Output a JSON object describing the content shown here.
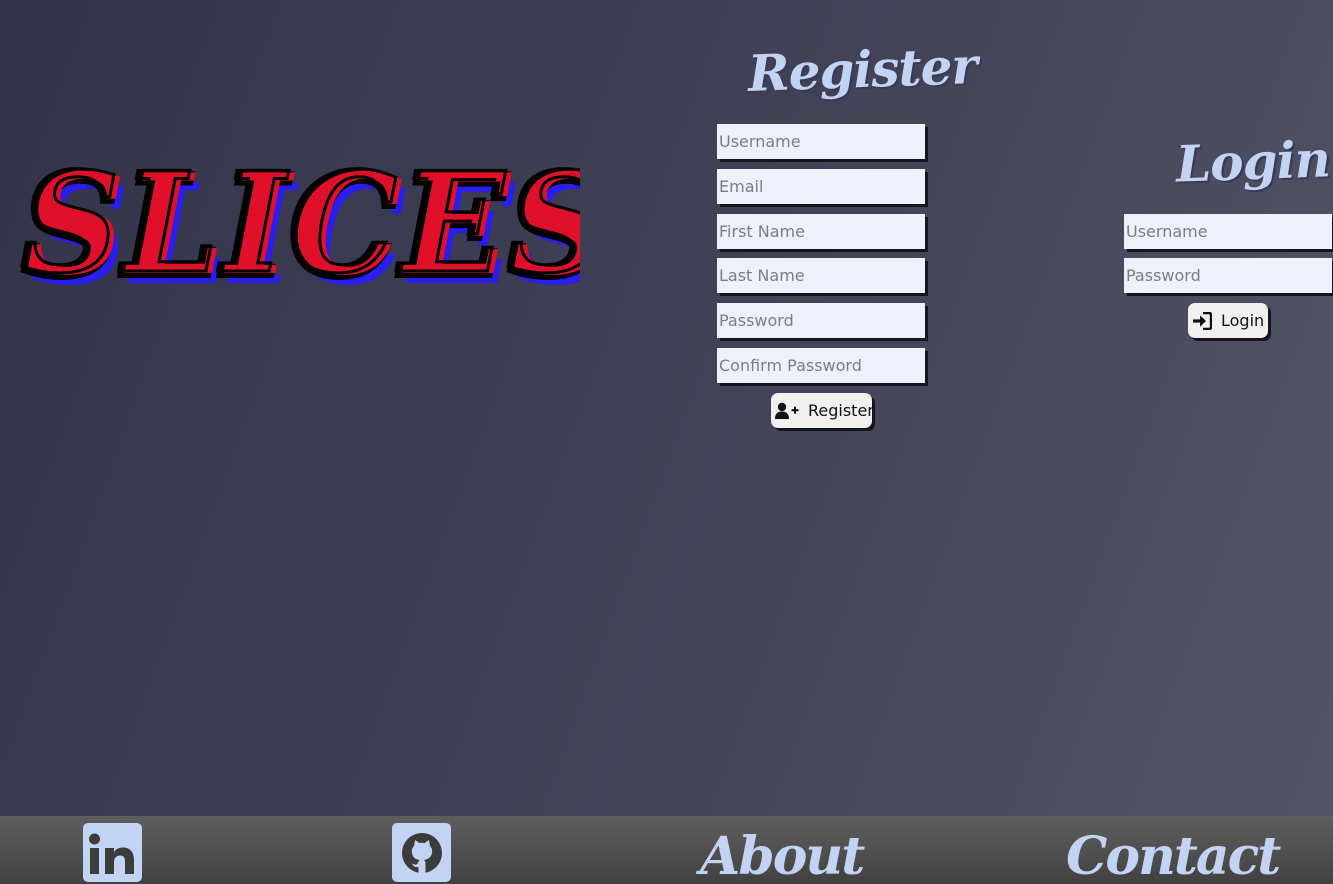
{
  "logo": {
    "text": "SLICES"
  },
  "register": {
    "heading": "Register",
    "fields": [
      {
        "name": "username",
        "placeholder": "Username",
        "type": "text"
      },
      {
        "name": "email",
        "placeholder": "Email",
        "type": "email"
      },
      {
        "name": "first_name",
        "placeholder": "First Name",
        "type": "text"
      },
      {
        "name": "last_name",
        "placeholder": "Last Name",
        "type": "text"
      },
      {
        "name": "password",
        "placeholder": "Password",
        "type": "password"
      },
      {
        "name": "confirm_password",
        "placeholder": "Confirm Password",
        "type": "password"
      }
    ],
    "button_label": "Register",
    "button_icon": "user-plus-icon"
  },
  "login": {
    "heading": "Login",
    "fields": [
      {
        "name": "username",
        "placeholder": "Username",
        "type": "text"
      },
      {
        "name": "password",
        "placeholder": "Password",
        "type": "password"
      }
    ],
    "button_label": "Login",
    "button_icon": "sign-in-icon"
  },
  "footer": {
    "linkedin_icon": "linkedin-icon",
    "github_icon": "github-icon",
    "about_label": "About",
    "contact_label": "Contact"
  },
  "colors": {
    "accent": "#c3d3f3",
    "field_bg": "#eff0fa",
    "logo_red": "#e0102a",
    "logo_blue": "#2a1df0",
    "footer_bg": "#505050"
  }
}
